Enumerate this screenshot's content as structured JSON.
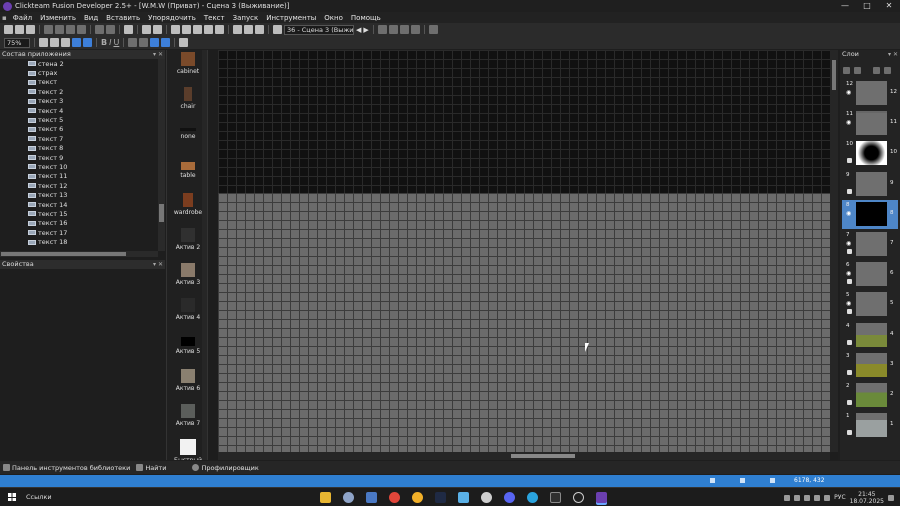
{
  "window": {
    "title": "Clickteam Fusion Developer 2.5+ - [W.M.W (Приват) - Сцена 3 (Выживание)]",
    "controls": [
      "—",
      "□",
      "✕"
    ]
  },
  "menu": [
    "Файл",
    "Изменить",
    "Вид",
    "Вставить",
    "Упорядочить",
    "Текст",
    "Запуск",
    "Инструменты",
    "Окно",
    "Помощь"
  ],
  "toolbar": {
    "zoom": "75%",
    "bold": "B",
    "italic": "I",
    "underline": "U",
    "frame_select": "36 - Сцена 3 (Выжив."
  },
  "app_tree": {
    "header": "Состав приложения",
    "items": [
      "стена 2",
      "страх",
      "текст",
      "текст 2",
      "текст 3",
      "текст 4",
      "текст 5",
      "текст 6",
      "текст 7",
      "текст 8",
      "текст 9",
      "текст 10",
      "текст 11",
      "текст 12",
      "текст 13",
      "текст 14",
      "текст 15",
      "текст 16",
      "текст 17",
      "текст 18"
    ]
  },
  "properties": {
    "header": "Свойства"
  },
  "library": {
    "items": [
      "cabinet",
      "chair",
      "none",
      "table",
      "wardrobe",
      "Актив 2",
      "Актив 3",
      "Актив 4",
      "Актив 5",
      "Актив 6",
      "Актив 7",
      "Быстрый"
    ]
  },
  "layers": {
    "header": "Слои",
    "items": [
      {
        "num": "12",
        "visible": true,
        "locked": false,
        "active": false
      },
      {
        "num": "11",
        "visible": true,
        "locked": false,
        "active": false
      },
      {
        "num": "10",
        "visible": false,
        "locked": true,
        "active": false
      },
      {
        "num": "9",
        "visible": false,
        "locked": true,
        "active": false
      },
      {
        "num": "8",
        "visible": true,
        "locked": false,
        "active": true
      },
      {
        "num": "7",
        "visible": true,
        "locked": true,
        "active": false
      },
      {
        "num": "6",
        "visible": true,
        "locked": true,
        "active": false
      },
      {
        "num": "5",
        "visible": true,
        "locked": true,
        "active": false
      },
      {
        "num": "4",
        "visible": false,
        "locked": true,
        "active": false
      },
      {
        "num": "3",
        "visible": false,
        "locked": true,
        "active": false
      },
      {
        "num": "2",
        "visible": false,
        "locked": true,
        "active": false
      },
      {
        "num": "1",
        "visible": false,
        "locked": true,
        "active": false
      }
    ]
  },
  "bottom_tabs": [
    "Панель инструментов библиотеки",
    "Найти",
    "Профилировщик"
  ],
  "status": {
    "coords": "6178, 432"
  },
  "taskbar": {
    "search": "Ссылки",
    "lang": "РУС",
    "time": "21:45",
    "date": "18.07.2025"
  },
  "colors": {
    "accent": "#2f7fd1",
    "layer_selected": "#4e86c7",
    "canvas_dark": "#111111",
    "canvas_grey": "#6b6b6b"
  }
}
